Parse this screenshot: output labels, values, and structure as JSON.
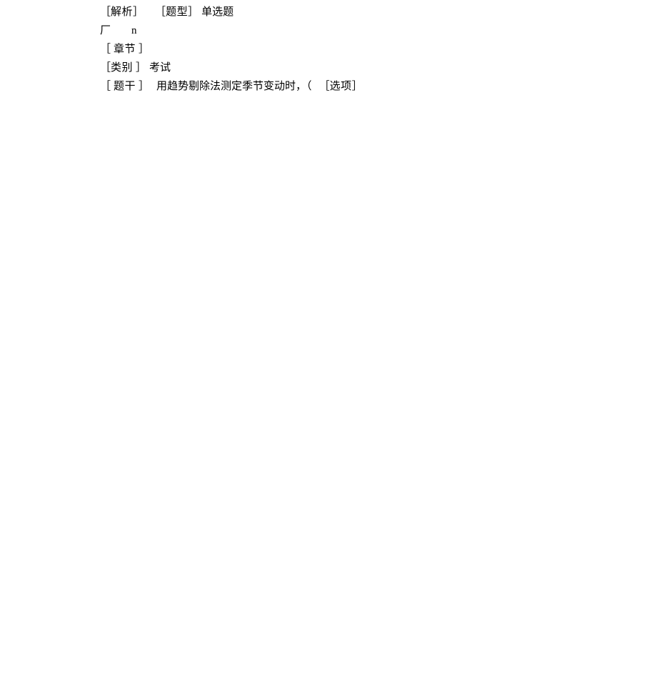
{
  "line1": {
    "tag1_open": "［",
    "tag1_label": "解析",
    "tag1_close": "］",
    "tag2_open": "［",
    "tag2_label": "题型",
    "tag2_close": "］",
    "value": "单选题"
  },
  "line2": {
    "text_a": "厂",
    "text_b": "n"
  },
  "line3": {
    "open": "［",
    "label": "章节",
    "close": "］"
  },
  "line4": {
    "open": "［",
    "label": "类别",
    "close": "］",
    "value": "考试"
  },
  "line5": {
    "open": "［",
    "label": "题干",
    "close": "］",
    "stem": "用趋势剔除法测定季节变动时，（",
    "tag2_open": "［",
    "tag2_label": "选项",
    "tag2_close": "］"
  }
}
